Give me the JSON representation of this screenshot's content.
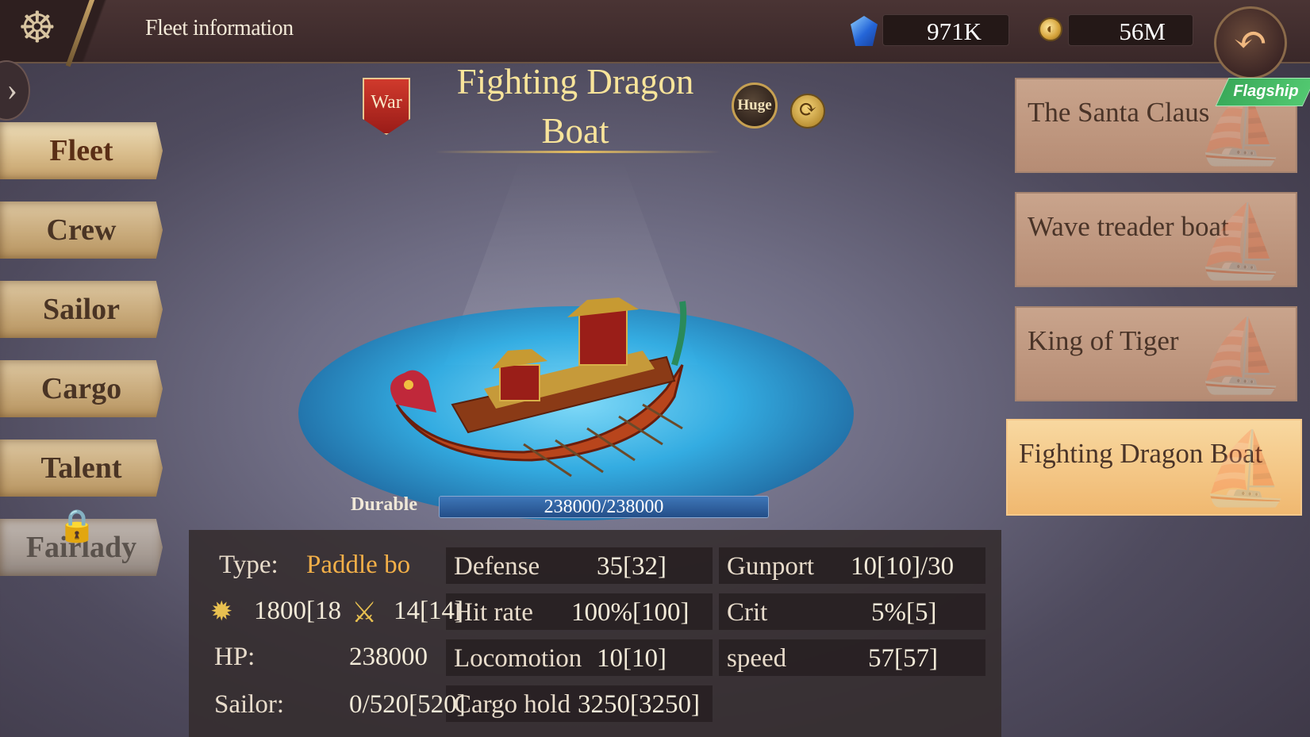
{
  "header": {
    "title": "Fleet information",
    "gems": "971K",
    "gold": "56M"
  },
  "sidebar": {
    "tabs": [
      {
        "label": "Fleet"
      },
      {
        "label": "Crew"
      },
      {
        "label": "Sailor"
      },
      {
        "label": "Cargo"
      },
      {
        "label": "Talent"
      },
      {
        "label": "Fairlady"
      }
    ]
  },
  "ship": {
    "class_badge": "War",
    "name": "Fighting Dragon Boat",
    "size_badge": "Huge",
    "durable_label": "Durable",
    "durable_text": "238000/238000",
    "durable_fraction": 1.0
  },
  "stats": {
    "type_label": "Type:",
    "type_value": "Paddle bo",
    "cannon_value": "1800[18",
    "melee_value": "14[14]",
    "hp_label": "HP:",
    "hp_value": "238000",
    "sailor_label": "Sailor:",
    "sailor_value": "0/520[520]",
    "defense_label": "Defense",
    "defense_value": "35[32]",
    "hitrate_label": "Hit rate",
    "hitrate_value": "100%[100]",
    "locomotion_label": "Locomotion",
    "locomotion_value": "10[10]",
    "cargo_label": "Cargo hold",
    "cargo_value": "3250[3250]",
    "gunport_label": "Gunport",
    "gunport_value": "10[10]/30",
    "crit_label": "Crit",
    "crit_value": "5%[5]",
    "speed_label": "speed",
    "speed_value": "57[57]"
  },
  "ship_list": {
    "flagship_label": "Flagship",
    "items": [
      {
        "name": "The Santa Claus"
      },
      {
        "name": "Wave treader boat"
      },
      {
        "name": "King of Tiger"
      },
      {
        "name": "Fighting Dragon Boat"
      }
    ]
  },
  "icons": {
    "menu": "ship-wheel-icon",
    "gem": "blue-gem-icon",
    "gold": "gold-coin-icon",
    "back": "back-arrow-icon",
    "lock": "lock-icon",
    "cannon": "cannon-icon",
    "melee": "crossed-swords-icon",
    "swap": "swap-icon"
  },
  "colors": {
    "accent_gold": "#f8e49a",
    "type_orange": "#f4b048",
    "flagship_green": "#3aaa5a"
  }
}
